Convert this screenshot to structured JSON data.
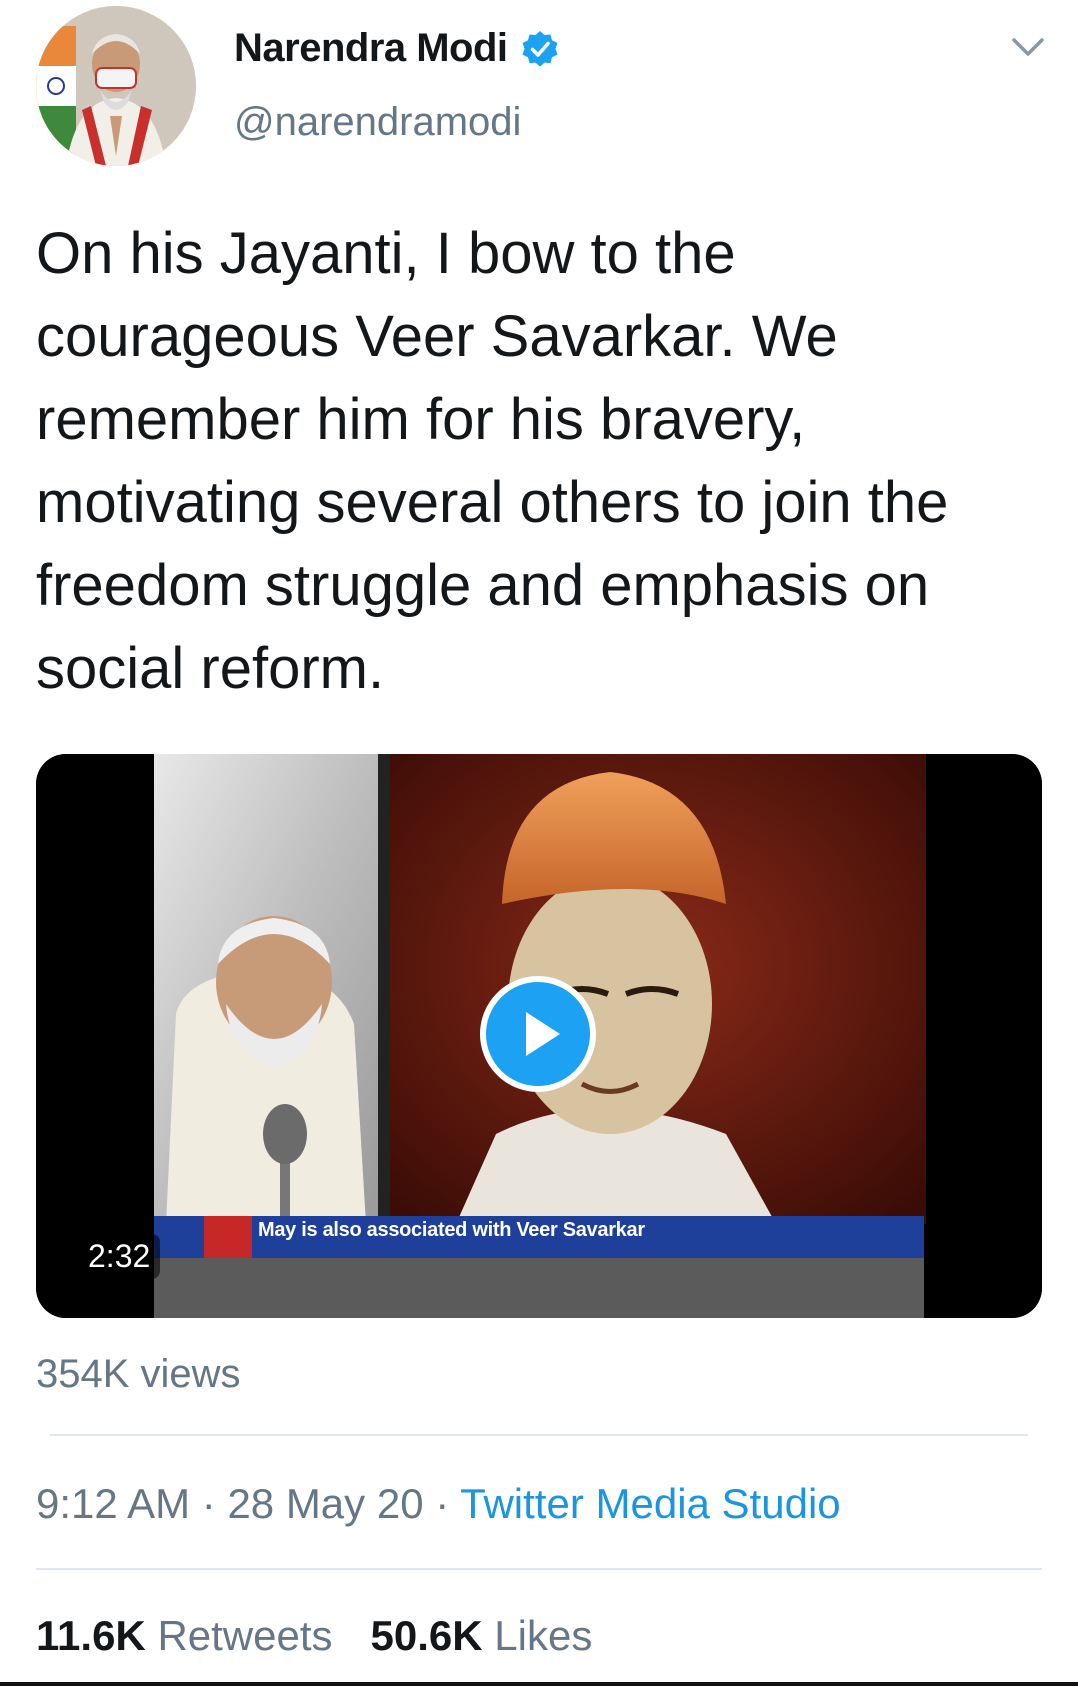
{
  "author": {
    "name": "Narendra Modi",
    "handle": "@narendramodi"
  },
  "icons": {
    "verified": "verified-badge-icon",
    "menu": "chevron-down-icon",
    "play": "play-icon"
  },
  "tweet": {
    "text": "On his Jayanti, I bow to the courageous Veer Savarkar. We remember him for his bravery, motivating several others to join the freedom struggle and emphasis on social reform."
  },
  "media": {
    "duration": "2:32",
    "ticker_text": "May is also associated with Veer Savarkar"
  },
  "views": "354K views",
  "meta": {
    "time": "9:12 AM",
    "separator": " · ",
    "date": "28 May 20",
    "source": "Twitter Media Studio"
  },
  "stats": {
    "retweets_count": "11.6K",
    "retweets_label": "Retweets",
    "likes_count": "50.6K",
    "likes_label": "Likes"
  },
  "colors": {
    "accent": "#1da1f2",
    "link": "#1b95e0",
    "secondary_text": "#657786",
    "primary_text": "#14171a"
  }
}
